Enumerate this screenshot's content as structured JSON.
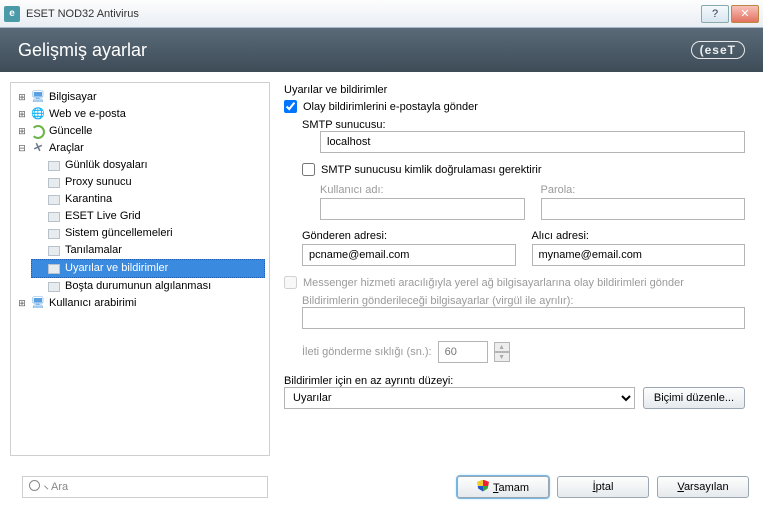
{
  "window": {
    "title": "ESET NOD32 Antivirus"
  },
  "header": {
    "title": "Gelişmiş ayarlar",
    "brand": "(eseT"
  },
  "tree": {
    "bilgisayar": "Bilgisayar",
    "web": "Web ve e-posta",
    "guncelle": "Güncelle",
    "araclar": "Araçlar",
    "gunluk": "Günlük dosyaları",
    "proxy": "Proxy sunucu",
    "karantina": "Karantina",
    "livegrid": "ESET Live Grid",
    "sistem": "Sistem güncellemeleri",
    "tanilamalar": "Tanılamalar",
    "uyarilar": "Uyarılar ve bildirimler",
    "bosta": "Boşta durumunun algılanması",
    "arabirim": "Kullanıcı arabirimi"
  },
  "form": {
    "section": "Uyarılar ve bildirimler",
    "send_email": "Olay bildirimlerini e-postayla gönder",
    "smtp_label": "SMTP sunucusu:",
    "smtp_value": "localhost",
    "smtp_auth": "SMTP sunucusu kimlik doğrulaması gerektirir",
    "user_label": "Kullanıcı adı:",
    "user_value": "",
    "pass_label": "Parola:",
    "pass_value": "",
    "from_label": "Gönderen adresi:",
    "from_value": "pcname@email.com",
    "to_label": "Alıcı adresi:",
    "to_value": "myname@email.com",
    "messenger": "Messenger hizmeti aracılığıyla yerel ağ bilgisayarlarına olay bildirimleri gönder",
    "messenger_targets_label": "Bildirimlerin gönderileceği bilgisayarlar (virgül ile ayrılır):",
    "messenger_targets_value": "",
    "interval_label": "İleti gönderme sıklığı (sn.):",
    "interval_value": "60",
    "verbosity_label": "Bildirimler için en az ayrıntı düzeyi:",
    "verbosity_value": "Uyarılar",
    "edit_format": "Biçimi düzenle..."
  },
  "footer": {
    "search_placeholder": "Ara",
    "ok_prefix": "T",
    "ok_rest": "amam",
    "cancel_prefix": "İ",
    "cancel_rest": "ptal",
    "default_prefix": "V",
    "default_rest": "arsayılan"
  }
}
